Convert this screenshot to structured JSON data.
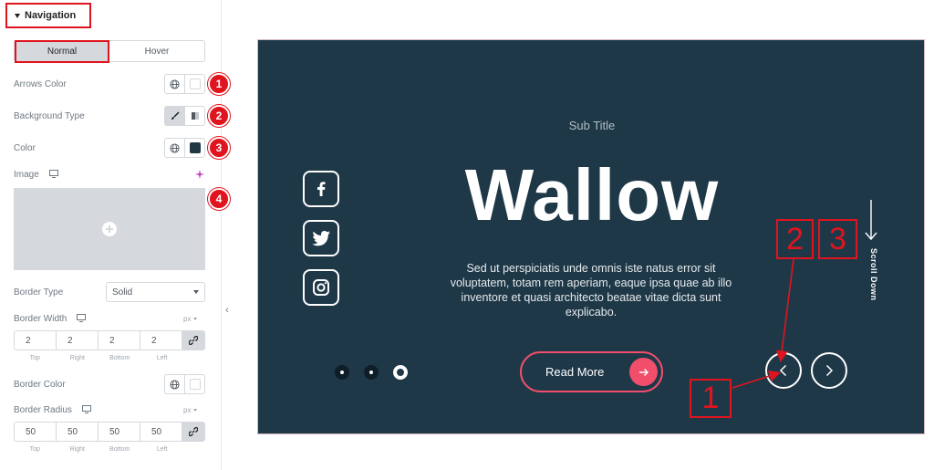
{
  "panel": {
    "section_title": "Navigation",
    "tabs": [
      {
        "label": "Normal",
        "active": true
      },
      {
        "label": "Hover",
        "active": false
      }
    ],
    "arrows_color_label": "Arrows Color",
    "background_type_label": "Background Type",
    "color_label": "Color",
    "image_label": "Image",
    "border_type_label": "Border Type",
    "border_type_value": "Solid",
    "border_width_label": "Border Width",
    "border_width_unit": "px",
    "border_width_values": [
      "2",
      "2",
      "2",
      "2"
    ],
    "border_color_label": "Border Color",
    "border_radius_label": "Border Radius",
    "border_radius_unit": "px",
    "border_radius_values": [
      "50",
      "50",
      "50",
      "50"
    ],
    "dimension_labels": [
      "Top",
      "Right",
      "Bottom",
      "Left"
    ],
    "badges": [
      "1",
      "2",
      "3",
      "4"
    ]
  },
  "preview": {
    "subtitle": "Sub Title",
    "title": "Wallow",
    "description": "Sed ut perspiciatis unde omnis iste natus error sit voluptatem, totam rem aperiam, eaque ipsa quae ab illo inventore et quasi architecto beatae vitae dicta sunt explicabo.",
    "button_label": "Read More",
    "scroll_label": "Scroll Down",
    "annotations": [
      "1",
      "2",
      "3"
    ]
  },
  "colors": {
    "accent_red": "#e0141e",
    "preview_bg": "#1e3848",
    "button_pink": "#f04e6b"
  },
  "icons": [
    "caret-down-icon",
    "globe-icon",
    "brush-icon",
    "gradient-icon",
    "monitor-icon",
    "ai-sparkle-icon",
    "plus-icon",
    "link-icon",
    "chevron-left-icon",
    "facebook-icon",
    "twitter-icon",
    "instagram-icon",
    "arrow-right-icon",
    "arrow-down-icon"
  ]
}
